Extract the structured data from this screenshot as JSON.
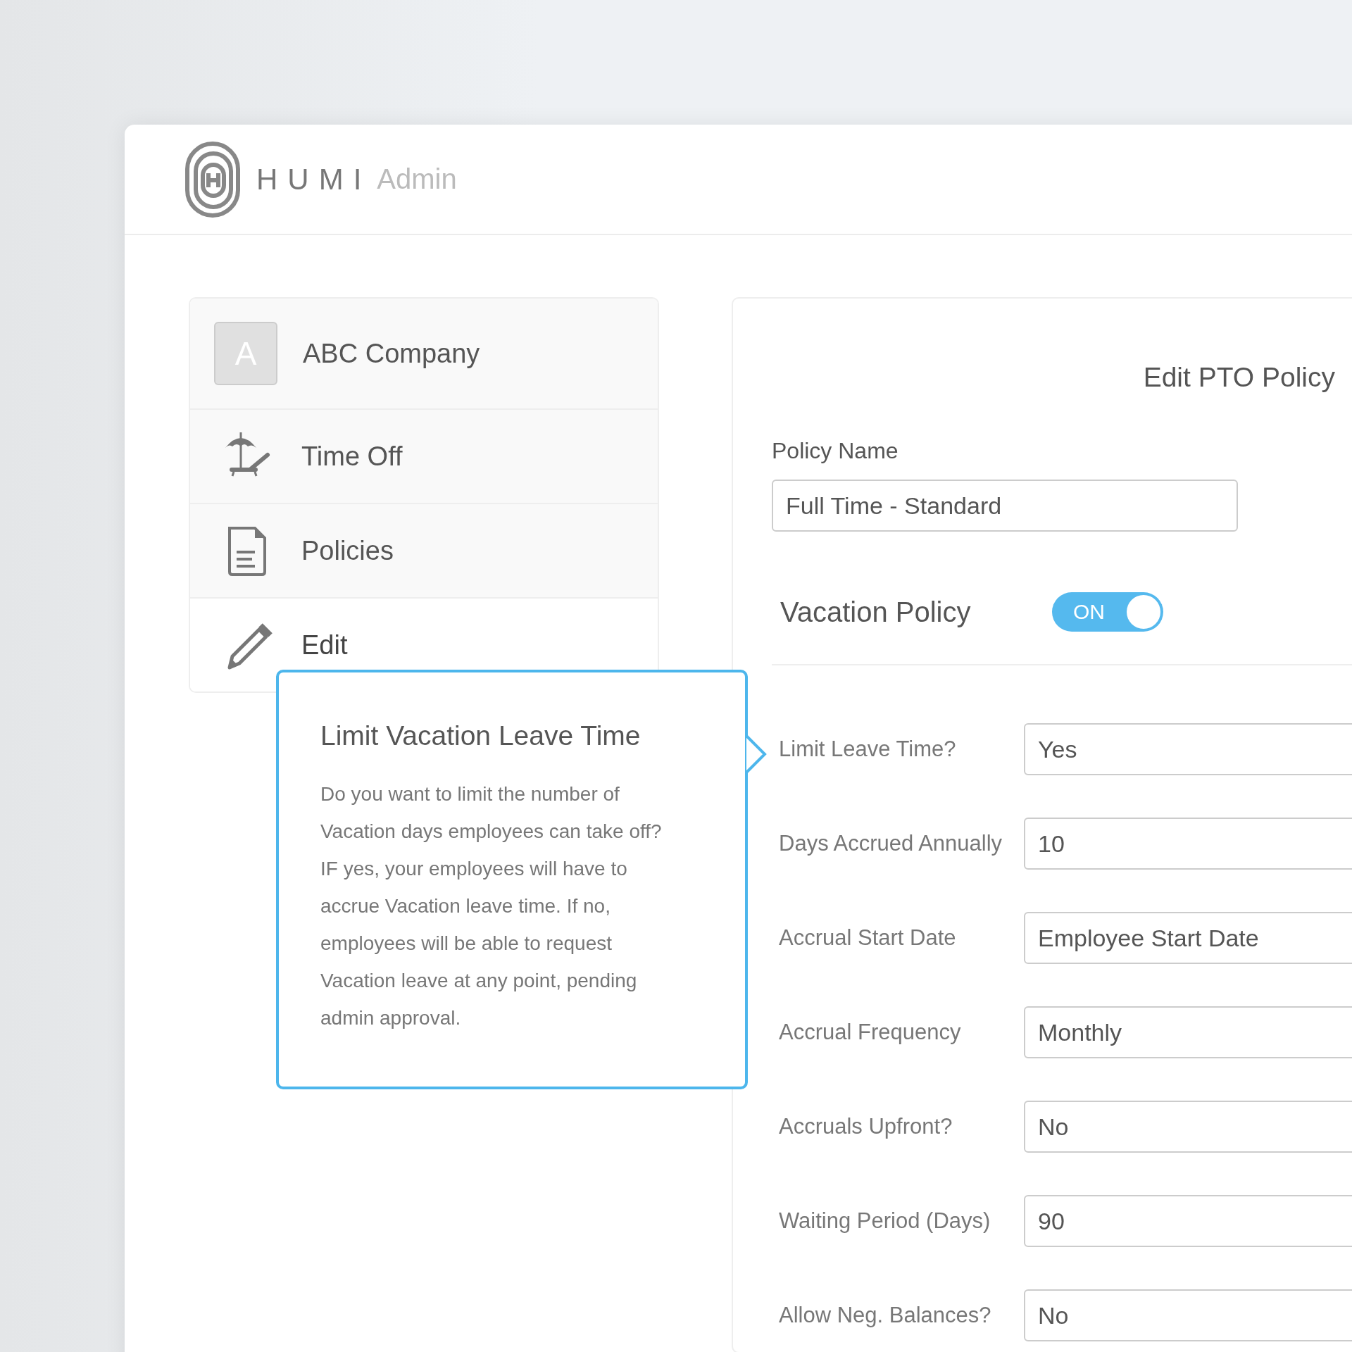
{
  "header": {
    "brand": "HUMI",
    "product": "Admin"
  },
  "sidebar": {
    "items": [
      {
        "kind": "company",
        "avatar": "A",
        "label": "ABC Company",
        "selected": false
      },
      {
        "kind": "time_off",
        "label": "Time Off",
        "selected": false
      },
      {
        "kind": "policies",
        "label": "Policies",
        "selected": false
      },
      {
        "kind": "edit",
        "label": "Edit",
        "selected": true
      }
    ]
  },
  "panel": {
    "title": "Edit PTO Policy",
    "policy_name": {
      "label": "Policy Name",
      "value": "Full Time - Standard"
    },
    "vacation": {
      "label": "Vacation Policy",
      "toggle_text": "ON",
      "on": true
    },
    "fields": [
      {
        "label": "Limit Leave Time?",
        "value": "Yes"
      },
      {
        "label": "Days Accrued Annually",
        "value": "10"
      },
      {
        "label": "Accrual Start Date",
        "value": "Employee Start Date"
      },
      {
        "label": "Accrual Frequency",
        "value": "Monthly"
      },
      {
        "label": "Accruals Upfront?",
        "value": "No"
      },
      {
        "label": "Waiting Period (Days)",
        "value": "90"
      },
      {
        "label": "Allow Neg. Balances?",
        "value": "No"
      }
    ]
  },
  "tooltip": {
    "title": "Limit Vacation Leave Time",
    "body": "Do you want to limit the number of Vacation days employees can take off? IF yes, your employees will have to accrue Vacation leave time. If no, employees will be able to request Vacation leave at any point, pending admin approval."
  }
}
